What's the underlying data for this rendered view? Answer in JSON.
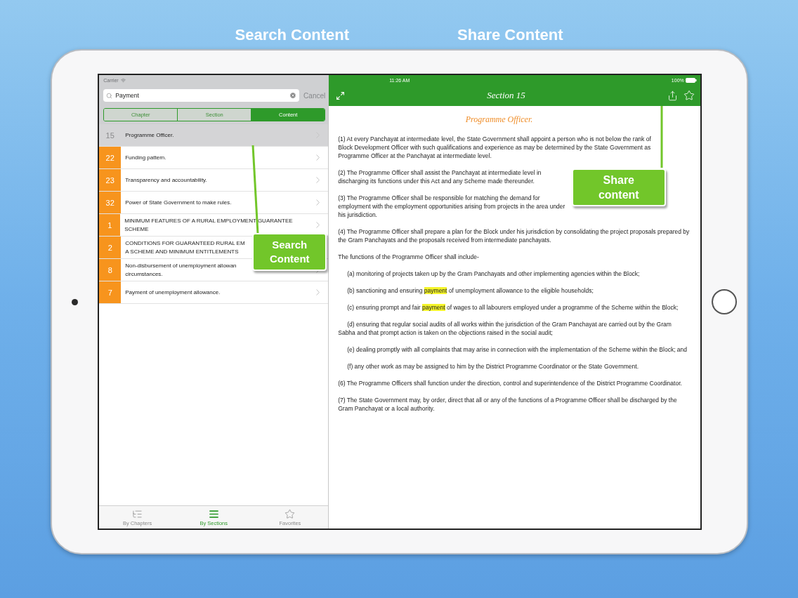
{
  "promo_headings": [
    "Search Content",
    "Share Content"
  ],
  "sidebar": {
    "status_bar": {
      "carrier": "Carrier"
    },
    "search": {
      "value": "Payment",
      "cancel": {
        "label": "Cancel",
        "disabled": true
      }
    },
    "segments": [
      {
        "label": "Chapter",
        "selected": false
      },
      {
        "label": "Section",
        "selected": false
      },
      {
        "label": "Content",
        "selected": true
      }
    ],
    "rows": [
      {
        "number": "15",
        "title": "Programme Officer.",
        "selected": true
      },
      {
        "number": "22",
        "title": "Funding pattern.",
        "selected": false
      },
      {
        "number": "23",
        "title": "Transparency and accountability.",
        "selected": false
      },
      {
        "number": "32",
        "title": "Power of State Government to make rules.",
        "selected": false
      },
      {
        "number": "1",
        "title": "MINIMUM FEATURES OF A RURAL EMPLOYMENT GUARANTEE SCHEME",
        "selected": false
      },
      {
        "number": "2",
        "title": "CONDITIONS FOR GUARANTEED RURAL EM\nA SCHEME AND MINIMUM ENTITLEMENTS",
        "selected": false
      },
      {
        "number": "8",
        "title": "Non-disbursement of unemployment allowan\ncircumstances.",
        "selected": false
      },
      {
        "number": "7",
        "title": "Payment of unemployment allowance.",
        "selected": false
      }
    ],
    "tab_bar": [
      {
        "label": "By Chapters",
        "selected": false
      },
      {
        "label": "By Sections",
        "selected": true
      },
      {
        "label": "Favorites",
        "selected": false
      }
    ]
  },
  "detail": {
    "status_bar": {
      "time": "11:26 AM",
      "battery": "100%"
    },
    "title": "Section 15",
    "heading": "Programme Officer.",
    "paragraphs": [
      {
        "kind": "clause",
        "parts": [
          {
            "text": "(1) At every Panchayat at intermediate level, the State Government shall appoint a person who is not below the rank of Block Development Officer with such qualifications and experience as may be determined by the State Government as Programme Officer at the Panchayat at intermediate level.",
            "highlighted": false
          }
        ]
      },
      {
        "kind": "clause",
        "parts": [
          {
            "text": "(2) The Programme Officer shall assist the Panchayat at intermediate level in discharging its functions under this Act and any Scheme made thereunder.",
            "highlighted": false
          }
        ]
      },
      {
        "kind": "clause",
        "parts": [
          {
            "text": "(3) The Programme Officer shall be responsible for matching the demand for employment with the employment opportunities arising from projects in the area under his jurisdiction.",
            "highlighted": false
          }
        ]
      },
      {
        "kind": "clause",
        "parts": [
          {
            "text": "(4) The Programme Officer shall prepare a plan for the Block under his jurisdiction by consolidating the project proposals prepared by the Gram Panchayats and the proposals received from intermediate panchayats.",
            "highlighted": false
          }
        ]
      },
      {
        "kind": "clause",
        "parts": [
          {
            "text": "The functions of the Programme Officer shall include-",
            "highlighted": false
          }
        ]
      },
      {
        "kind": "item",
        "parts": [
          {
            "text": "(a) monitoring of projects taken up by the Gram Panchayats and other implementing agencies within the Block;",
            "highlighted": false
          }
        ]
      },
      {
        "kind": "item",
        "parts": [
          {
            "text": "(b) sanctioning and ensuring ",
            "highlighted": false
          },
          {
            "text": "payment",
            "highlighted": true
          },
          {
            "text": " of unemployment allowance to the eligible households;",
            "highlighted": false
          }
        ]
      },
      {
        "kind": "item",
        "parts": [
          {
            "text": "(c) ensuring prompt and fair ",
            "highlighted": false
          },
          {
            "text": "payment",
            "highlighted": true
          },
          {
            "text": " of wages to all labourers employed under a programme of the Scheme within the Block;",
            "highlighted": false
          }
        ]
      },
      {
        "kind": "item",
        "parts": [
          {
            "text": "(d) ensuring that regular social audits of all works within the jurisdiction of the Gram Panchayat are carried out by the Gram Sabha and that prompt action is taken on the objections raised in the social audit;",
            "highlighted": false
          }
        ]
      },
      {
        "kind": "item",
        "parts": [
          {
            "text": "(e) dealing promptly with all complaints that may arise in connection with the implementation of the Scheme within the Block; and",
            "highlighted": false
          }
        ]
      },
      {
        "kind": "item",
        "parts": [
          {
            "text": "(f) any other work as may be assigned to him by the District Programme Coordinator or the State Government.",
            "highlighted": false
          }
        ]
      },
      {
        "kind": "clause",
        "parts": [
          {
            "text": "(6) The Programme Officers shall function under the direction, control and superintendence of the District Programme Coordinator.",
            "highlighted": false
          }
        ]
      },
      {
        "kind": "clause",
        "parts": [
          {
            "text": "(7) The State Government may, by order, direct that all or any of the functions of a Programme Officer shall be discharged by the Gram Panchayat or a local authority.",
            "highlighted": false
          }
        ]
      }
    ]
  },
  "callouts": [
    {
      "text": "Search Content"
    },
    {
      "text": "Share content"
    }
  ]
}
